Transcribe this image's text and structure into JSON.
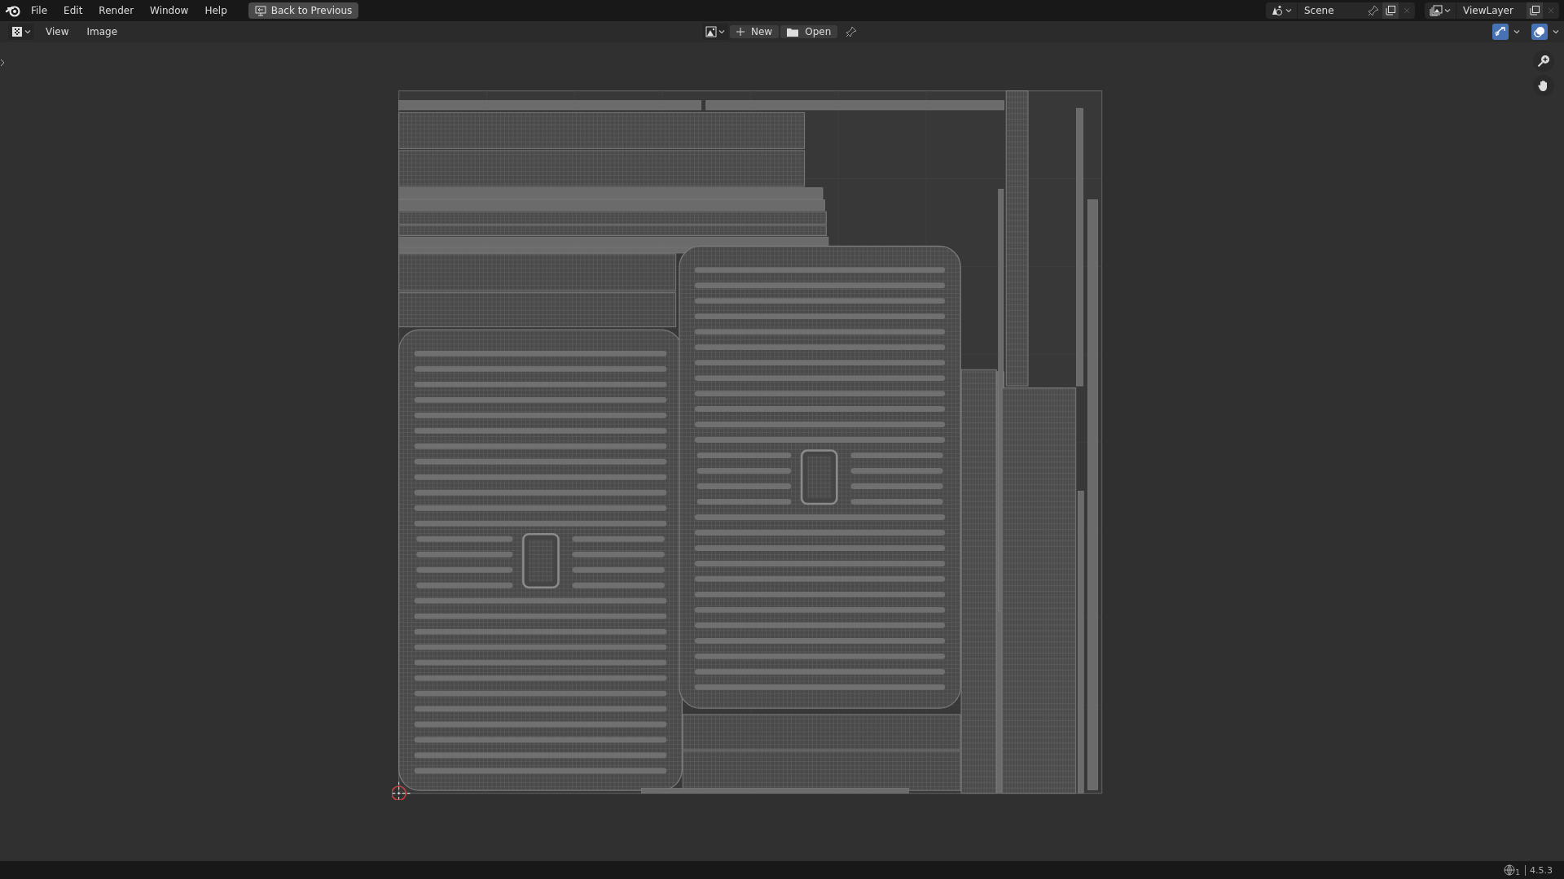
{
  "top_bar": {
    "menus": [
      "File",
      "Edit",
      "Render",
      "Window",
      "Help"
    ],
    "back_button": "Back to Previous",
    "scene": {
      "name": "Scene"
    },
    "view_layer": {
      "name": "ViewLayer"
    }
  },
  "editor_header": {
    "menus": [
      "View",
      "Image"
    ],
    "new_button": "New",
    "open_button": "Open"
  },
  "status_bar": {
    "scene_count": "1",
    "version": "4.5.3"
  }
}
